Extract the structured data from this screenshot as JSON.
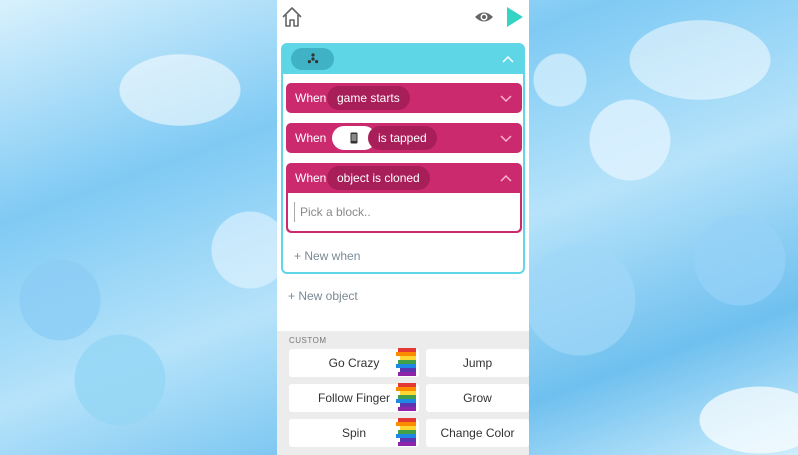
{
  "editor": {
    "rules": [
      {
        "when": "When",
        "trigger": "game starts"
      },
      {
        "when": "When",
        "trigger": "is tapped"
      },
      {
        "when": "When",
        "trigger": "object is cloned",
        "placeholder": "Pick a block.."
      }
    ],
    "new_when": "+ New when",
    "new_object": "+ New object"
  },
  "palette": {
    "section_label": "CUSTOM",
    "blocks": [
      {
        "label": "Go Crazy"
      },
      {
        "label": "Jump"
      },
      {
        "label": "Follow Finger"
      },
      {
        "label": "Grow"
      },
      {
        "label": "Spin"
      },
      {
        "label": "Change Color"
      }
    ]
  },
  "colors": {
    "accent_cyan": "#5fd6e6",
    "rule_magenta": "#cc2a6e",
    "play_teal": "#35d3c4"
  },
  "icons": [
    "home-icon",
    "eye-icon",
    "play-icon",
    "fidget-spinner-icon",
    "chevron-up-icon",
    "chevron-down-icon",
    "phone-icon",
    "rainbow-icon"
  ]
}
